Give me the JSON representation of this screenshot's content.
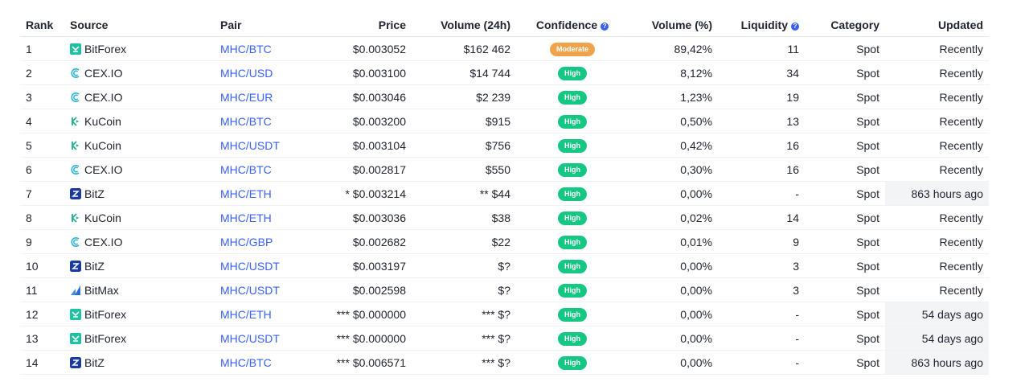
{
  "header": {
    "rank": "Rank",
    "source": "Source",
    "pair": "Pair",
    "price": "Price",
    "volume": "Volume (24h)",
    "confidence": "Confidence",
    "volume_pct": "Volume (%)",
    "liquidity": "Liquidity",
    "category": "Category",
    "updated": "Updated",
    "help_glyph": "?"
  },
  "colors": {
    "high": "#16c784",
    "moderate": "#f0a34a",
    "link": "#3861fb",
    "stale_bg": "#f3f4f6"
  },
  "exchange_icons": {
    "BitForex": "bitforex-icon",
    "CEX.IO": "cexio-icon",
    "KuCoin": "kucoin-icon",
    "BitZ": "bitz-icon",
    "BitMax": "bitmax-icon"
  },
  "rows": [
    {
      "rank": "1",
      "source": "BitForex",
      "pair": "MHC/BTC",
      "price": "$0.003052",
      "volume": "$162 462",
      "confidence": "Moderate",
      "volume_pct": "89,42%",
      "liquidity": "11",
      "category": "Spot",
      "updated": "Recently",
      "stale": false
    },
    {
      "rank": "2",
      "source": "CEX.IO",
      "pair": "MHC/USD",
      "price": "$0.003100",
      "volume": "$14 744",
      "confidence": "High",
      "volume_pct": "8,12%",
      "liquidity": "34",
      "category": "Spot",
      "updated": "Recently",
      "stale": false
    },
    {
      "rank": "3",
      "source": "CEX.IO",
      "pair": "MHC/EUR",
      "price": "$0.003046",
      "volume": "$2 239",
      "confidence": "High",
      "volume_pct": "1,23%",
      "liquidity": "19",
      "category": "Spot",
      "updated": "Recently",
      "stale": false
    },
    {
      "rank": "4",
      "source": "KuCoin",
      "pair": "MHC/BTC",
      "price": "$0.003200",
      "volume": "$915",
      "confidence": "High",
      "volume_pct": "0,50%",
      "liquidity": "13",
      "category": "Spot",
      "updated": "Recently",
      "stale": false
    },
    {
      "rank": "5",
      "source": "KuCoin",
      "pair": "MHC/USDT",
      "price": "$0.003104",
      "volume": "$756",
      "confidence": "High",
      "volume_pct": "0,42%",
      "liquidity": "16",
      "category": "Spot",
      "updated": "Recently",
      "stale": false
    },
    {
      "rank": "6",
      "source": "CEX.IO",
      "pair": "MHC/BTC",
      "price": "$0.002817",
      "volume": "$550",
      "confidence": "High",
      "volume_pct": "0,30%",
      "liquidity": "16",
      "category": "Spot",
      "updated": "Recently",
      "stale": false
    },
    {
      "rank": "7",
      "source": "BitZ",
      "pair": "MHC/ETH",
      "price": "* $0.003214",
      "volume": "** $44",
      "confidence": "High",
      "volume_pct": "0,00%",
      "liquidity": "-",
      "category": "Spot",
      "updated": "863 hours ago",
      "stale": true
    },
    {
      "rank": "8",
      "source": "KuCoin",
      "pair": "MHC/ETH",
      "price": "$0.003036",
      "volume": "$38",
      "confidence": "High",
      "volume_pct": "0,02%",
      "liquidity": "14",
      "category": "Spot",
      "updated": "Recently",
      "stale": false
    },
    {
      "rank": "9",
      "source": "CEX.IO",
      "pair": "MHC/GBP",
      "price": "$0.002682",
      "volume": "$22",
      "confidence": "High",
      "volume_pct": "0,01%",
      "liquidity": "9",
      "category": "Spot",
      "updated": "Recently",
      "stale": false
    },
    {
      "rank": "10",
      "source": "BitZ",
      "pair": "MHC/USDT",
      "price": "$0.003197",
      "volume": "$?",
      "confidence": "High",
      "volume_pct": "0,00%",
      "liquidity": "3",
      "category": "Spot",
      "updated": "Recently",
      "stale": false
    },
    {
      "rank": "11",
      "source": "BitMax",
      "pair": "MHC/USDT",
      "price": "$0.002598",
      "volume": "$?",
      "confidence": "High",
      "volume_pct": "0,00%",
      "liquidity": "3",
      "category": "Spot",
      "updated": "Recently",
      "stale": false
    },
    {
      "rank": "12",
      "source": "BitForex",
      "pair": "MHC/ETH",
      "price": "*** $0.000000",
      "volume": "*** $?",
      "confidence": "High",
      "volume_pct": "0,00%",
      "liquidity": "-",
      "category": "Spot",
      "updated": "54 days ago",
      "stale": true
    },
    {
      "rank": "13",
      "source": "BitForex",
      "pair": "MHC/USDT",
      "price": "*** $0.000000",
      "volume": "*** $?",
      "confidence": "High",
      "volume_pct": "0,00%",
      "liquidity": "-",
      "category": "Spot",
      "updated": "54 days ago",
      "stale": true
    },
    {
      "rank": "14",
      "source": "BitZ",
      "pair": "MHC/BTC",
      "price": "*** $0.006571",
      "volume": "*** $?",
      "confidence": "High",
      "volume_pct": "0,00%",
      "liquidity": "-",
      "category": "Spot",
      "updated": "863 hours ago",
      "stale": true
    }
  ]
}
